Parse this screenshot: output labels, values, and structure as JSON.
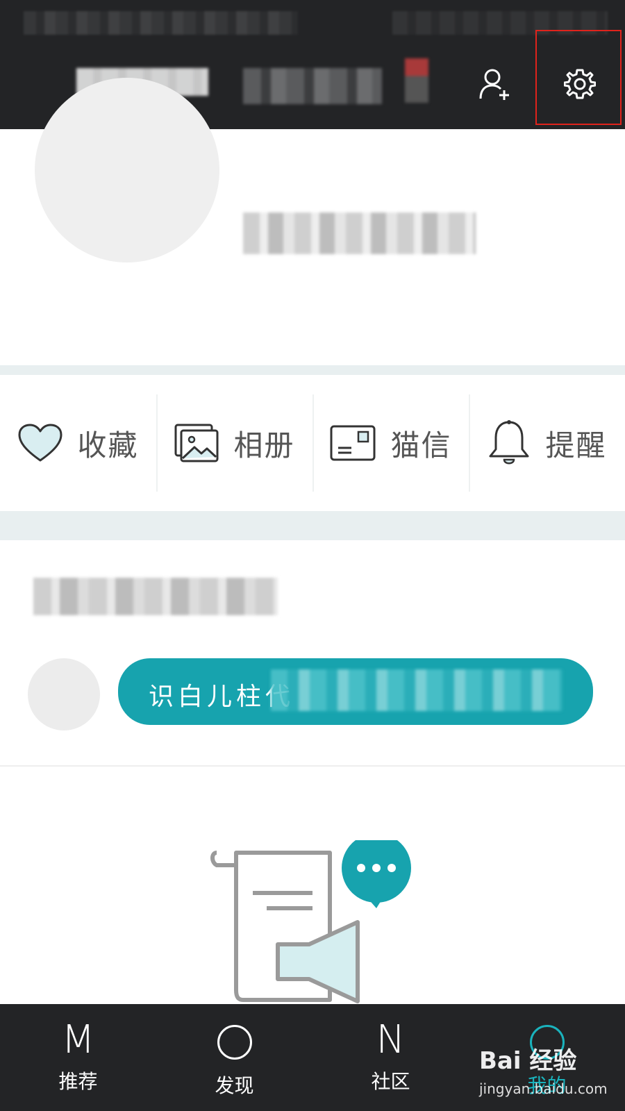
{
  "header": {
    "add_user_icon": "add-user-icon",
    "settings_icon": "gear-icon"
  },
  "quick_actions": [
    {
      "label": "收藏",
      "icon": "heart-icon"
    },
    {
      "label": "相册",
      "icon": "photo-album-icon"
    },
    {
      "label": "猫信",
      "icon": "mail-card-icon"
    },
    {
      "label": "提醒",
      "icon": "bell-icon"
    }
  ],
  "feed": {
    "bubble_text": "识白儿柱代"
  },
  "bottom_nav": [
    {
      "glyph": "M",
      "label": "推荐"
    },
    {
      "glyph": "",
      "label": "发现"
    },
    {
      "glyph": "N",
      "label": "社区"
    },
    {
      "glyph": "",
      "label": "我的"
    }
  ],
  "watermark": {
    "brand": "Bai 经验",
    "url": "jingyan.baidu.com"
  },
  "colors": {
    "accent": "#17a3ae",
    "header_bg": "#232426",
    "highlight": "#e0231c"
  }
}
